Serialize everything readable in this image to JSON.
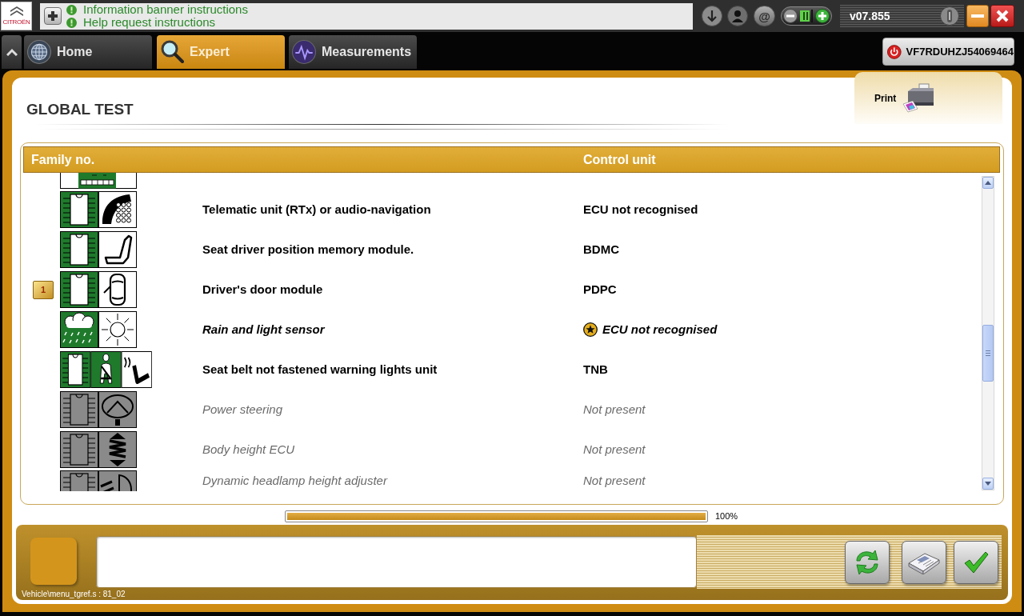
{
  "top_bar": {
    "logo_text": "CITROËN",
    "banner_lines": [
      "Information banner instructions",
      "Help request instructions"
    ],
    "email_label": "@",
    "version": "v07.855"
  },
  "nav_tabs": [
    {
      "label": "Home",
      "selected": false
    },
    {
      "label": "Expert",
      "selected": true
    },
    {
      "label": "Measurements",
      "selected": false
    }
  ],
  "vin_button": {
    "label": "VF7RDUHZJ54069464"
  },
  "page": {
    "title": "GLOBAL TEST",
    "print_label": "Print"
  },
  "table": {
    "columns": [
      "Family no.",
      "Control unit"
    ],
    "rows": [
      {
        "name": "Telematic unit (RTx) or audio-navigation",
        "control_unit": "ECU not recognised",
        "present": true,
        "flagged": false
      },
      {
        "name": "Seat driver position memory module.",
        "control_unit": "BDMC",
        "present": true,
        "flagged": false
      },
      {
        "name": "Driver's door module",
        "control_unit": "PDPC",
        "present": true,
        "flagged": false,
        "badge": "1"
      },
      {
        "name": "Rain and light sensor",
        "control_unit": "ECU not recognised",
        "present": true,
        "flagged": true
      },
      {
        "name": "Seat belt not fastened warning lights unit",
        "control_unit": "TNB",
        "present": true,
        "flagged": false
      },
      {
        "name": "Power steering",
        "control_unit": "Not present",
        "present": false,
        "flagged": false
      },
      {
        "name": "Body height ECU",
        "control_unit": "Not present",
        "present": false,
        "flagged": false
      },
      {
        "name": "Dynamic headlamp height adjuster",
        "control_unit": "Not present",
        "present": false,
        "flagged": false
      }
    ]
  },
  "progress": {
    "level": 1,
    "reading": "100%"
  },
  "footer": {
    "path": "Vehicle\\menu_tgref.s : 81_02"
  }
}
